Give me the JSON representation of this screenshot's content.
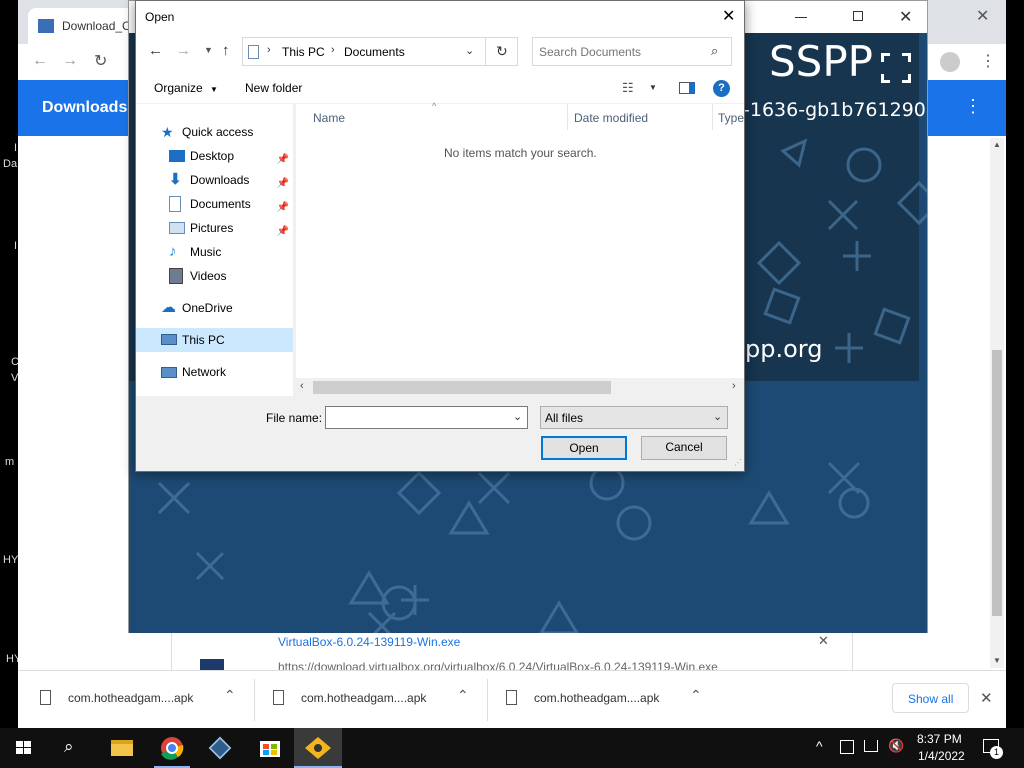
{
  "desktop": {
    "labels": [
      "I",
      "Da",
      "I",
      "C",
      "V",
      "m",
      "HY",
      "HY"
    ]
  },
  "chrome": {
    "tab_title": "Download_C",
    "header_title": "Downloads",
    "download_card": {
      "filename": "VirtualBox-6.0.24-139119-Win.exe",
      "url": "https://download.virtualbox.org/virtualbox/6.0.24/VirtualBox-6.0.24-139119-Win.exe"
    }
  },
  "ppsspp": {
    "logo_text": "SSPP",
    "version_text": "-1636-gb1b761290",
    "site_text": "pp.org"
  },
  "dialog": {
    "title": "Open",
    "breadcrumb": [
      "This PC",
      "Documents"
    ],
    "search_placeholder": "Search Documents",
    "organize_label": "Organize",
    "new_folder_label": "New folder",
    "columns": [
      "Name",
      "Date modified",
      "Type"
    ],
    "empty_message": "No items match your search.",
    "nav": {
      "quick_access": "Quick access",
      "desktop": "Desktop",
      "downloads": "Downloads",
      "documents": "Documents",
      "pictures": "Pictures",
      "music": "Music",
      "videos": "Videos",
      "onedrive": "OneDrive",
      "this_pc": "This PC",
      "network": "Network"
    },
    "filename_label": "File name:",
    "filename_value": "",
    "filter_value": "All files",
    "open_label": "Open",
    "cancel_label": "Cancel"
  },
  "download_bar": {
    "items": [
      "com.hotheadgam....apk",
      "com.hotheadgam....apk",
      "com.hotheadgam....apk"
    ],
    "show_all_label": "Show all"
  },
  "taskbar": {
    "time": "8:37 PM",
    "date": "1/4/2022",
    "notification_count": "1"
  },
  "colors": {
    "chrome_accent": "#1a73e8",
    "ppsspp_bg": "#1d4a74",
    "dialog_selected": "#cce8ff",
    "button_focus": "#0078d7"
  }
}
